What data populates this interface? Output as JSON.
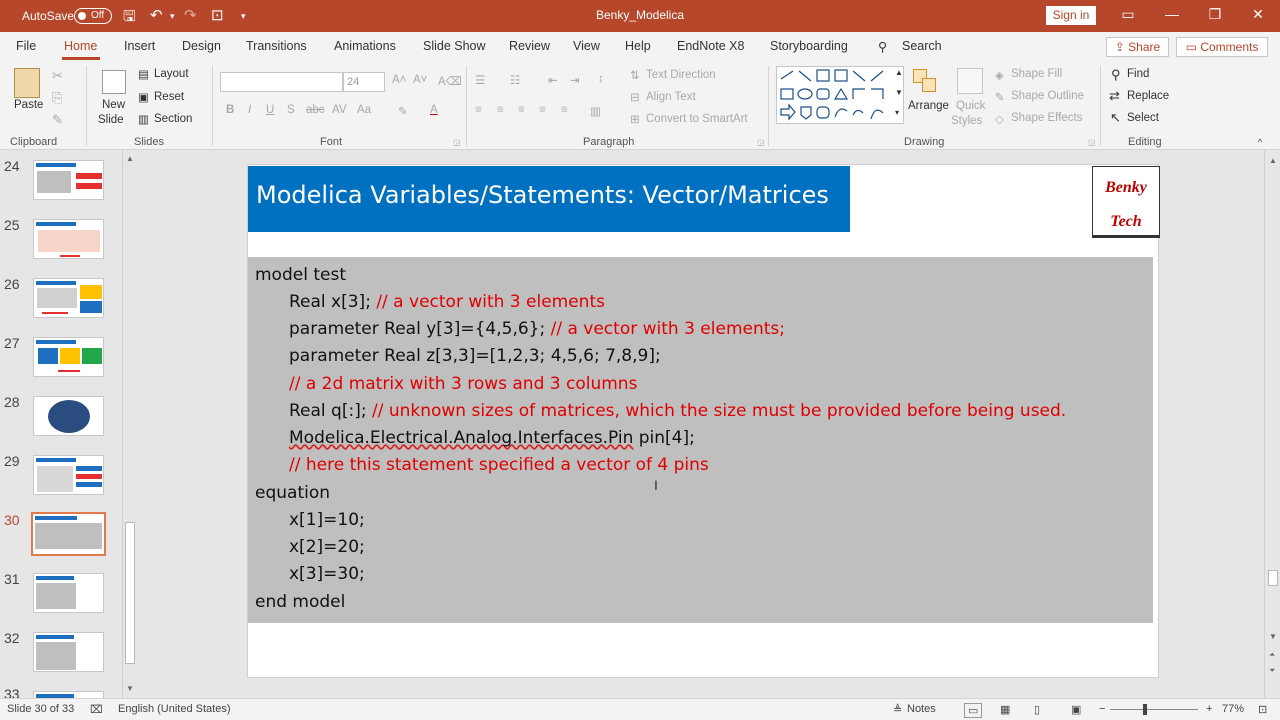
{
  "window": {
    "autosave_label": "AutoSave",
    "autosave_state": "Off",
    "title": "Benky_Modelica",
    "signin_label": "Sign in"
  },
  "tabs": [
    "File",
    "Home",
    "Insert",
    "Design",
    "Transitions",
    "Animations",
    "Slide Show",
    "Review",
    "View",
    "Help",
    "EndNote X8",
    "Storyboarding"
  ],
  "search_placeholder": "Search",
  "share_label": "Share",
  "comments_label": "Comments",
  "ribbon": {
    "clipboard": {
      "paste": "Paste",
      "group": "Clipboard"
    },
    "slides": {
      "new_slide_1": "New",
      "new_slide_2": "Slide",
      "layout": "Layout",
      "reset": "Reset",
      "section": "Section",
      "group": "Slides"
    },
    "font": {
      "size": "24",
      "group": "Font"
    },
    "paragraph": {
      "text_direction": "Text Direction",
      "align_text": "Align Text",
      "convert_smartart": "Convert to SmartArt",
      "group": "Paragraph"
    },
    "drawing": {
      "arrange": "Arrange",
      "quick_styles_1": "Quick",
      "quick_styles_2": "Styles",
      "shape_fill": "Shape Fill",
      "shape_outline": "Shape Outline",
      "shape_effects": "Shape Effects",
      "group": "Drawing"
    },
    "editing": {
      "find": "Find",
      "replace": "Replace",
      "select": "Select",
      "group": "Editing"
    }
  },
  "thumbnails": {
    "numbers": [
      "24",
      "25",
      "26",
      "27",
      "28",
      "29",
      "30",
      "31",
      "32",
      "33"
    ],
    "active": "30"
  },
  "slide": {
    "title": "Modelica Variables/Statements: Vector/Matrices",
    "logo_line1": "Benky",
    "logo_line2": "Tech",
    "code": {
      "l1": "model test",
      "l2_code": "Real x[3]; ",
      "l2_cmt": "// a vector with 3 elements",
      "l3_code": "parameter Real y[3]={4,5,6}; ",
      "l3_cmt": "// a vector with 3 elements;",
      "l4": "parameter Real z[3,3]=[1,2,3; 4,5,6; 7,8,9];",
      "l5_cmt": "// a 2d matrix with 3 rows and 3 columns",
      "l6_code": "Real q[:]; ",
      "l6_cmt": "// unknown sizes of matrices, which the size must be provided before being used.",
      "l7_sq": "Modelica.Electrical.Analog.Interfaces.Pin",
      "l7_rest": " pin[4];",
      "l8_cmt": "// here this statement specified a vector of 4 pins",
      "l9": "equation",
      "l10": "x[1]=10;",
      "l11": "x[2]=20;",
      "l12": "x[3]=30;",
      "l13": "end model"
    }
  },
  "status": {
    "slide_count": "Slide 30 of 33",
    "language": "English (United States)",
    "notes": "Notes",
    "zoom": "77%"
  }
}
